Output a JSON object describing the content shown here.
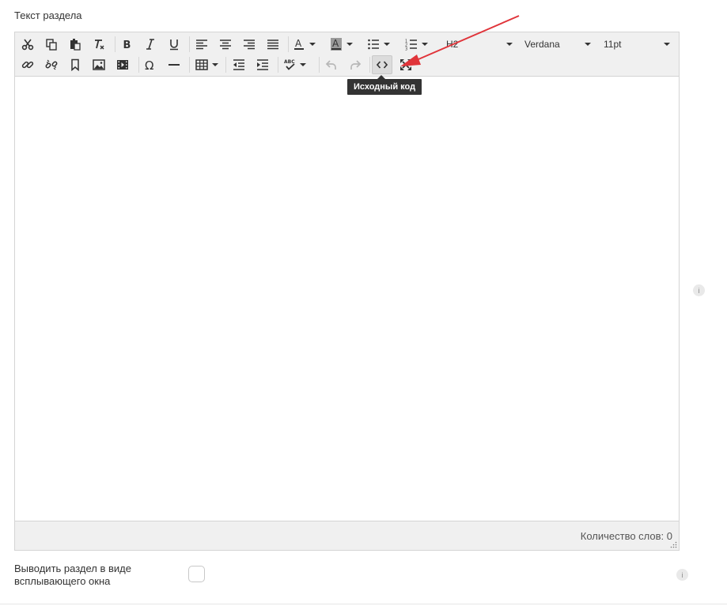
{
  "section": {
    "label": "Текст раздела"
  },
  "toolbar": {
    "format_block": "H2",
    "font_family": "Verdana",
    "font_size": "11pt",
    "tooltip": "Исходный код"
  },
  "status": {
    "word_count": "Количество слов: 0"
  },
  "popup": {
    "label_line1": "Выводить раздел в виде",
    "label_line2": "всплывающего окна"
  },
  "colors": {
    "annotation_arrow": "#e0343a",
    "toolbar_bg": "#f0f0f0",
    "tooltip_bg": "#333333"
  },
  "icons": [
    "cut-icon",
    "copy-icon",
    "paste-icon",
    "clear-format-icon",
    "bold-icon",
    "italic-icon",
    "underline-icon",
    "align-left-icon",
    "align-center-icon",
    "align-right-icon",
    "align-justify-icon",
    "text-color-icon",
    "background-color-icon",
    "bullet-list-icon",
    "numbered-list-icon",
    "link-icon",
    "unlink-icon",
    "bookmark-icon",
    "image-icon",
    "media-icon",
    "omega-icon",
    "horizontal-line-icon",
    "table-icon",
    "outdent-icon",
    "indent-icon",
    "spellcheck-icon",
    "undo-icon",
    "redo-icon",
    "source-code-icon",
    "fullscreen-icon",
    "info-icon"
  ]
}
